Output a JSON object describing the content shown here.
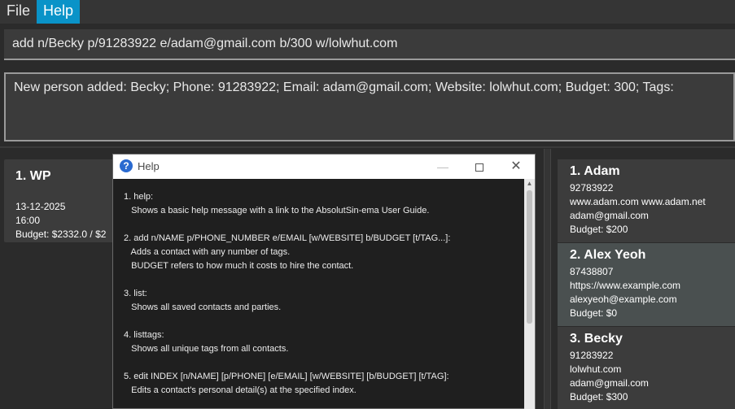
{
  "menu": {
    "file": "File",
    "help": "Help"
  },
  "command": {
    "value": "add n/Becky p/91283922 e/adam@gmail.com b/300 w/lolwhut.com"
  },
  "result": {
    "text": "New person added: Becky; Phone: 91283922; Email: adam@gmail.com; Website: lolwhut.com; Budget: 300; Tags:"
  },
  "party": {
    "name": "1. WP",
    "date": "13-12-2025",
    "time": "16:00",
    "budget": "Budget: $2332.0 / $2"
  },
  "persons": [
    {
      "name": "1. Adam",
      "phone": "92783922",
      "website": "www.adam.com www.adam.net",
      "email": "adam@gmail.com",
      "budget": "Budget: $200"
    },
    {
      "name": "2. Alex Yeoh",
      "phone": "87438807",
      "website": "https://www.example.com",
      "email": "alexyeoh@example.com",
      "budget": "Budget: $0"
    },
    {
      "name": "3. Becky",
      "phone": "91283922",
      "website": "lolwhut.com",
      "email": "adam@gmail.com",
      "budget": "Budget: $300"
    }
  ],
  "help_window": {
    "title": "Help",
    "icons": {
      "app": "help-question-icon",
      "minimize": "minimize-icon",
      "maximize": "maximize-icon",
      "close": "close-icon"
    },
    "lines": [
      "1. help:",
      "   Shows a basic help message with a link to the AbsolutSin-ema User Guide.",
      "",
      "2. add n/NAME p/PHONE_NUMBER e/EMAIL [w/WEBSITE] b/BUDGET [t/TAG...]:",
      "   Adds a contact with any number of tags.",
      "   BUDGET refers to how much it costs to hire the contact.",
      "",
      "3. list:",
      "   Shows all saved contacts and parties.",
      "",
      "4. listtags:",
      "   Shows all unique tags from all contacts.",
      "",
      "5. edit INDEX [n/NAME] [p/PHONE] [e/EMAIL] [w/WEBSITE] [b/BUDGET] [t/TAG]:",
      "   Edits a contact's personal detail(s) at the specified index."
    ]
  }
}
